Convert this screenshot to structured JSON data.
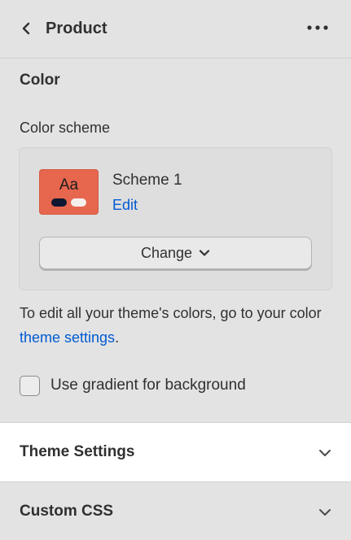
{
  "header": {
    "title": "Product",
    "back_icon": "chevron-left-icon",
    "more_icon": "more-horizontal-icon"
  },
  "color_section": {
    "heading": "Color",
    "color_scheme": {
      "label": "Color scheme",
      "swatch_text": "Aa",
      "swatch_bg_color": "#e6664e",
      "scheme_name": "Scheme 1",
      "edit_label": "Edit",
      "change_label": "Change"
    },
    "helper_text_prefix": "To edit all your theme's colors, go to your color ",
    "helper_link": "theme settings",
    "helper_text_suffix": ".",
    "gradient_checkbox": {
      "label": "Use gradient for background",
      "checked": false
    }
  },
  "accordions": [
    {
      "title": "Theme Settings",
      "expanded": false
    },
    {
      "title": "Custom CSS",
      "expanded": false
    }
  ],
  "colors": {
    "link": "#005bd3",
    "text": "#303030",
    "background": "#e3e3e3"
  }
}
